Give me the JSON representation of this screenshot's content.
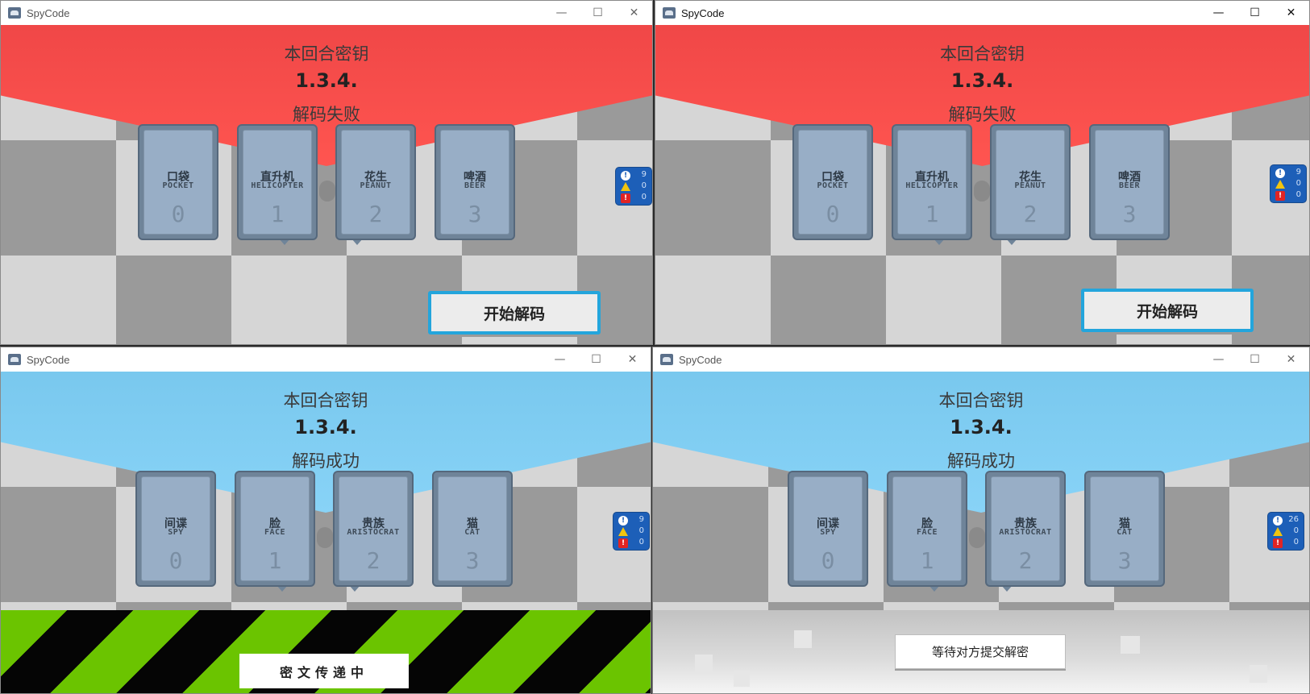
{
  "app_title": "SpyCode",
  "window_controls": {
    "minimize": "—",
    "maximize": "☐",
    "close": "✕"
  },
  "round": {
    "title": "本回合密钥",
    "key": "1.3.4."
  },
  "windows": [
    {
      "status": "解码失败",
      "result": "fail",
      "banner_color": "#ff5550",
      "cards": [
        {
          "cn": "口袋",
          "en": "POCKET",
          "num": "0"
        },
        {
          "cn": "直升机",
          "en": "HELICOPTER",
          "num": "1"
        },
        {
          "cn": "花生",
          "en": "PEANUT",
          "num": "2"
        },
        {
          "cn": "啤酒",
          "en": "BEER",
          "num": "3"
        }
      ],
      "stats": [
        "9",
        "0",
        "0"
      ],
      "action_button": "开始解码"
    },
    {
      "status": "解码失败",
      "result": "fail",
      "banner_color": "#ff5550",
      "cards": [
        {
          "cn": "口袋",
          "en": "POCKET",
          "num": "0"
        },
        {
          "cn": "直升机",
          "en": "HELICOPTER",
          "num": "1"
        },
        {
          "cn": "花生",
          "en": "PEANUT",
          "num": "2"
        },
        {
          "cn": "啤酒",
          "en": "BEER",
          "num": "3"
        }
      ],
      "stats": [
        "9",
        "0",
        "0"
      ],
      "action_button": "开始解码"
    },
    {
      "status": "解码成功",
      "result": "success",
      "banner_color": "#88d3f7",
      "cards": [
        {
          "cn": "间谍",
          "en": "SPY",
          "num": "0"
        },
        {
          "cn": "脸",
          "en": "FACE",
          "num": "1"
        },
        {
          "cn": "贵族",
          "en": "ARISTOCRAT",
          "num": "2"
        },
        {
          "cn": "猫",
          "en": "CAT",
          "num": "3"
        }
      ],
      "stats": [
        "9",
        "0",
        "0"
      ],
      "footer_status": "密文传递中"
    },
    {
      "status": "解码成功",
      "result": "success",
      "banner_color": "#88d3f7",
      "cards": [
        {
          "cn": "间谍",
          "en": "SPY",
          "num": "0"
        },
        {
          "cn": "脸",
          "en": "FACE",
          "num": "1"
        },
        {
          "cn": "贵族",
          "en": "ARISTOCRAT",
          "num": "2"
        },
        {
          "cn": "猫",
          "en": "CAT",
          "num": "3"
        }
      ],
      "stats": [
        "26",
        "0",
        "0"
      ],
      "footer_status": "等待对方提交解密"
    }
  ],
  "icons": {
    "info": "exclamation-circle-icon",
    "warn": "warning-triangle-icon",
    "error": "error-square-icon"
  },
  "colors": {
    "fail": "#ff5550",
    "success": "#88d3f7",
    "button_border": "#23a5dc",
    "stripe_green": "#6bc400",
    "stats_panel": "#1d5fb8"
  }
}
